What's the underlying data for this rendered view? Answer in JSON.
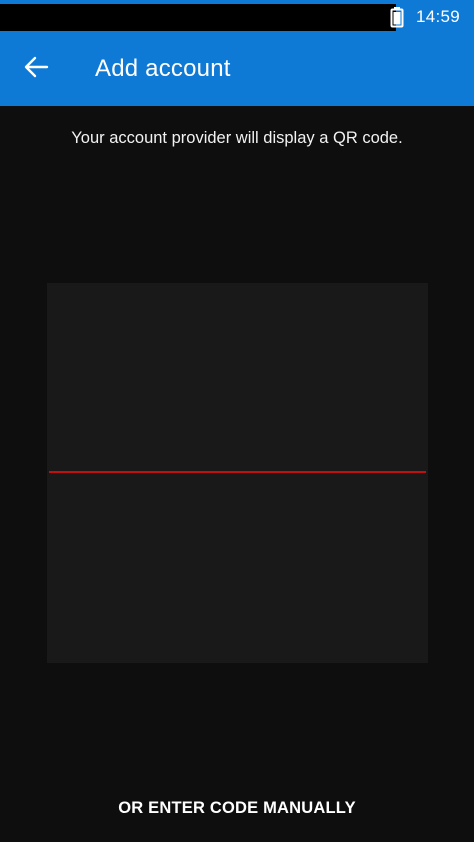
{
  "status_bar": {
    "time": "14:59",
    "battery_icon": "battery-icon"
  },
  "app_bar": {
    "back_icon": "arrow-left-icon",
    "title": "Add account",
    "color": "#0e7ad6"
  },
  "scanner": {
    "instruction": "Your account provider will display a QR code.",
    "scan_line_color": "#c21010"
  },
  "actions": {
    "enter_code_manually": "OR ENTER CODE MANUALLY"
  }
}
